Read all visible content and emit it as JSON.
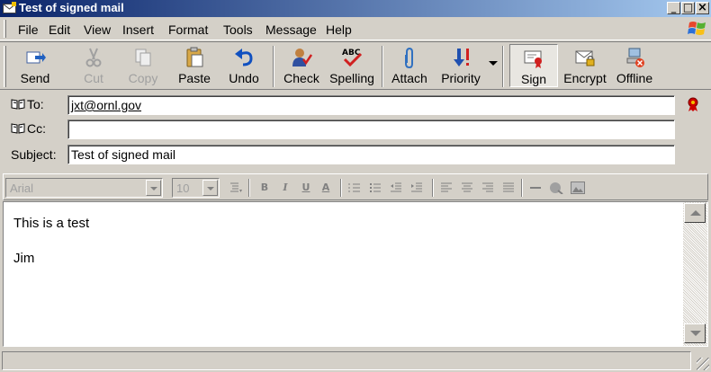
{
  "window": {
    "title": "Test of signed mail",
    "controls": {
      "minimize": "_",
      "maximize": "□",
      "close": "×"
    }
  },
  "menubar": {
    "items": [
      "File",
      "Edit",
      "View",
      "Insert",
      "Format",
      "Tools",
      "Message",
      "Help"
    ]
  },
  "toolbar": {
    "buttons": [
      {
        "label": "Send",
        "icon": "send-icon",
        "enabled": true
      },
      {
        "label": "Cut",
        "icon": "scissors-icon",
        "enabled": false
      },
      {
        "label": "Copy",
        "icon": "copy-icon",
        "enabled": false
      },
      {
        "label": "Paste",
        "icon": "paste-icon",
        "enabled": true
      },
      {
        "label": "Undo",
        "icon": "undo-icon",
        "enabled": true
      },
      {
        "label": "Check",
        "icon": "check-names-icon",
        "enabled": true
      },
      {
        "label": "Spelling",
        "icon": "spelling-icon",
        "enabled": true,
        "icon_text": "ABC"
      },
      {
        "label": "Attach",
        "icon": "paperclip-icon",
        "enabled": true
      },
      {
        "label": "Priority",
        "icon": "priority-icon",
        "enabled": true
      },
      {
        "label": "Sign",
        "icon": "sign-certificate-icon",
        "enabled": true,
        "pressed": true
      },
      {
        "label": "Encrypt",
        "icon": "encrypt-icon",
        "enabled": true
      },
      {
        "label": "Offline",
        "icon": "offline-icon",
        "enabled": true
      }
    ]
  },
  "header": {
    "to_label": "To:",
    "to_value": "jxt@ornl.gov",
    "cc_label": "Cc:",
    "cc_value": "",
    "subject_label": "Subject:",
    "subject_value": "Test of signed mail"
  },
  "format_toolbar": {
    "font_name": "Arial",
    "font_size": "10",
    "bold": "B",
    "italic": "I",
    "underline": "U",
    "font_color": "A"
  },
  "message": {
    "lines": [
      "This is a test",
      "Jim"
    ]
  },
  "colors": {
    "chrome": "#d4d0c8",
    "titlebar_start": "#0a246a",
    "titlebar_end": "#a6caf0",
    "disabled_text": "#a0a0a0",
    "signed_badge": "#cc0000"
  }
}
